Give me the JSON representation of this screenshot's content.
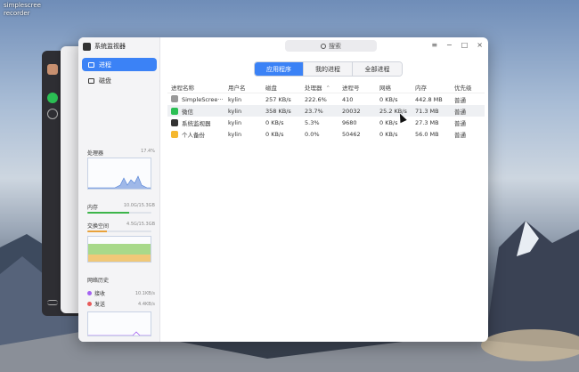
{
  "desktop": {
    "label1": "simplescree",
    "label2": "recorder"
  },
  "window": {
    "title": "系统监视器",
    "search_placeholder": "搜索"
  },
  "sidebar": {
    "nav": [
      {
        "label": "进程",
        "active": true
      },
      {
        "label": "磁盘",
        "active": false
      }
    ],
    "cpu": {
      "label": "处理器",
      "value": "17.4%"
    },
    "memory": {
      "label": "内存",
      "value": "10.0G/15.3GB",
      "fraction": 0.65
    },
    "swap": {
      "label": "交换空间",
      "value": "4.5G/15.3GB",
      "fraction": 0.3
    },
    "network": {
      "label": "网络历史",
      "receive": {
        "label": "接收",
        "rate": "10.1KB/s",
        "color": "#a463f2"
      },
      "send": {
        "label": "发送",
        "rate": "4.4KB/s",
        "color": "#e85a5a"
      }
    }
  },
  "tabs": [
    {
      "label": "应用程序",
      "active": true
    },
    {
      "label": "我的进程",
      "active": false
    },
    {
      "label": "全部进程",
      "active": false
    }
  ],
  "table": {
    "columns": [
      "进程名称",
      "用户名",
      "磁盘",
      "处理器",
      "进程号",
      "网络",
      "内存",
      "优先级"
    ],
    "rows": [
      {
        "name": "SimpleScree···",
        "icon": "screen-recorder-icon",
        "icon_color": "#999999",
        "user": "kylin",
        "disk": "257 KB/s",
        "cpu": "222.6%",
        "pid": "410",
        "net": "0 KB/s",
        "mem": "442.8 MB",
        "prio": "普通",
        "selected": false
      },
      {
        "name": "微信",
        "icon": "wechat-icon",
        "icon_color": "#2bbf54",
        "user": "kylin",
        "disk": "358 KB/s",
        "cpu": "23.7%",
        "pid": "20032",
        "net": "25.2 KB/s",
        "mem": "71.3 MB",
        "prio": "普通",
        "selected": true
      },
      {
        "name": "系统监视器",
        "icon": "system-monitor-icon",
        "icon_color": "#333333",
        "user": "kylin",
        "disk": "0 KB/s",
        "cpu": "5.3%",
        "pid": "9680",
        "net": "0 KB/s",
        "mem": "27.3 MB",
        "prio": "普通",
        "selected": false
      },
      {
        "name": "个人备份",
        "icon": "backup-icon",
        "icon_color": "#f5b82e",
        "user": "kylin",
        "disk": "0 KB/s",
        "cpu": "0.0%",
        "pid": "50462",
        "net": "0 KB/s",
        "mem": "56.0 MB",
        "prio": "普通",
        "selected": false
      }
    ]
  }
}
